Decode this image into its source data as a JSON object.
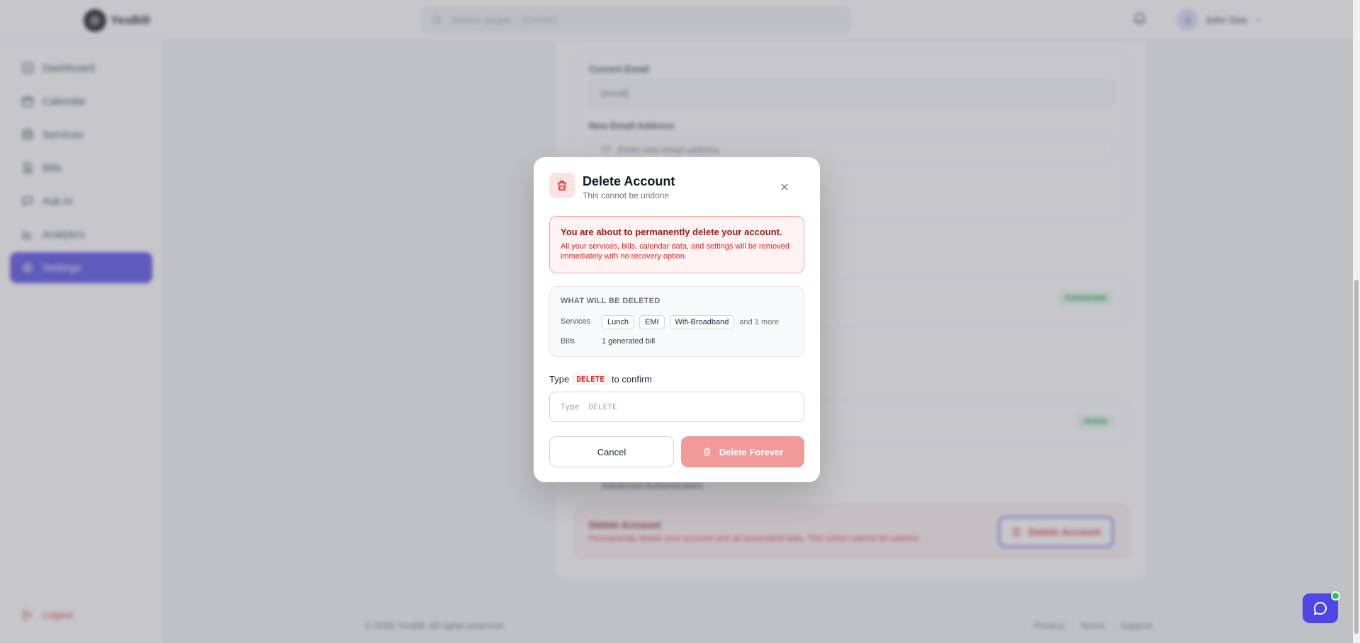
{
  "app": {
    "logo_text": "YesBill",
    "search_placeholder": "Search pages... (Ctrl+K)",
    "user_initial": "J",
    "user_name": "John Doe"
  },
  "sidebar": {
    "items": [
      {
        "label": "Dashboard",
        "icon": "dashboard-icon"
      },
      {
        "label": "Calendar",
        "icon": "calendar-icon"
      },
      {
        "label": "Services",
        "icon": "services-icon"
      },
      {
        "label": "Bills",
        "icon": "bills-icon"
      },
      {
        "label": "Ask AI",
        "icon": "chat-icon"
      },
      {
        "label": "Analytics",
        "icon": "analytics-icon"
      },
      {
        "label": "Settings",
        "icon": "gear-icon",
        "active": true
      }
    ],
    "logout_label": "Logout"
  },
  "background": {
    "current_email_label": "Current Email",
    "current_email_value": "[email]",
    "new_email_label": "New Email Address",
    "new_email_placeholder": "Enter new email address",
    "connected_badge": "Connected",
    "active_badge": "Active",
    "row_text": "Advanced Authentication",
    "danger_title": "Delete Account",
    "danger_desc": "Permanently delete your account and all associated data. This action cannot be undone.",
    "danger_button": "Delete Account"
  },
  "footer": {
    "copyright": "© 2026 YesBill. All rights reserved.",
    "links": [
      "Privacy",
      "Terms",
      "Support"
    ]
  },
  "modal": {
    "title": "Delete Account",
    "subtitle": "This cannot be undone",
    "warning_title": "You are about to permanently delete your account.",
    "warning_text": "All your services, bills, calendar data, and settings will be removed immediately with no recovery option.",
    "deleted_heading": "WHAT WILL BE DELETED",
    "services_label": "Services",
    "services": [
      "Lunch",
      "EMI",
      "Wifi-Broadband"
    ],
    "services_more": "and 1 more",
    "bills_label": "Bills",
    "bills_value": "1 generated bill",
    "confirm_prefix": "Type",
    "confirm_code": "DELETE",
    "confirm_suffix": "to confirm",
    "input_placeholder": "Type  DELETE",
    "input_value": "",
    "cancel_label": "Cancel",
    "delete_label": "Delete Forever"
  },
  "colors": {
    "accent": "#4f46e5",
    "danger": "#dc2626",
    "danger_disabled": "#f29a9a"
  }
}
